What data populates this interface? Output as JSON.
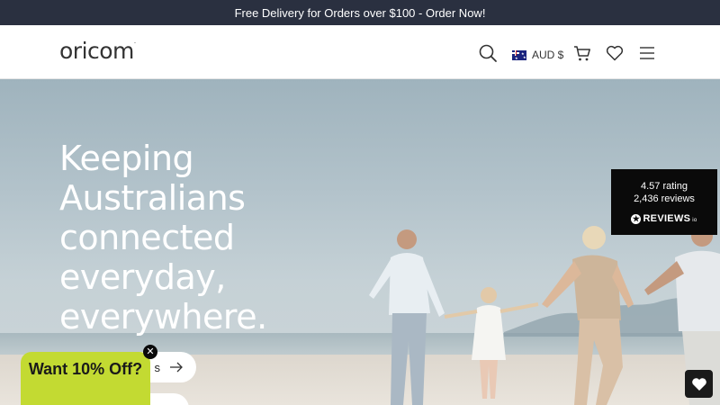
{
  "promo": {
    "text": "Free Delivery for Orders over $100 - Order Now!"
  },
  "header": {
    "logo": "oricom",
    "currency": "AUD $",
    "icons": [
      "search-icon",
      "cart-icon",
      "heart-icon",
      "menu-icon"
    ]
  },
  "hero": {
    "headline": "Keeping Australians connected everyday, everywhere.",
    "primary_button_label": "s",
    "secondary_button_label": ""
  },
  "reviews": {
    "rating_text": "4.57 rating",
    "count_text": "2,436 reviews",
    "brand": "REVIEWS",
    "brand_suffix": "io"
  },
  "offer": {
    "text": "Want 10% Off?"
  },
  "colors": {
    "promo_bg": "#2a3040",
    "offer_bg": "#c3da32",
    "badge_bg": "#0a0a0a"
  }
}
